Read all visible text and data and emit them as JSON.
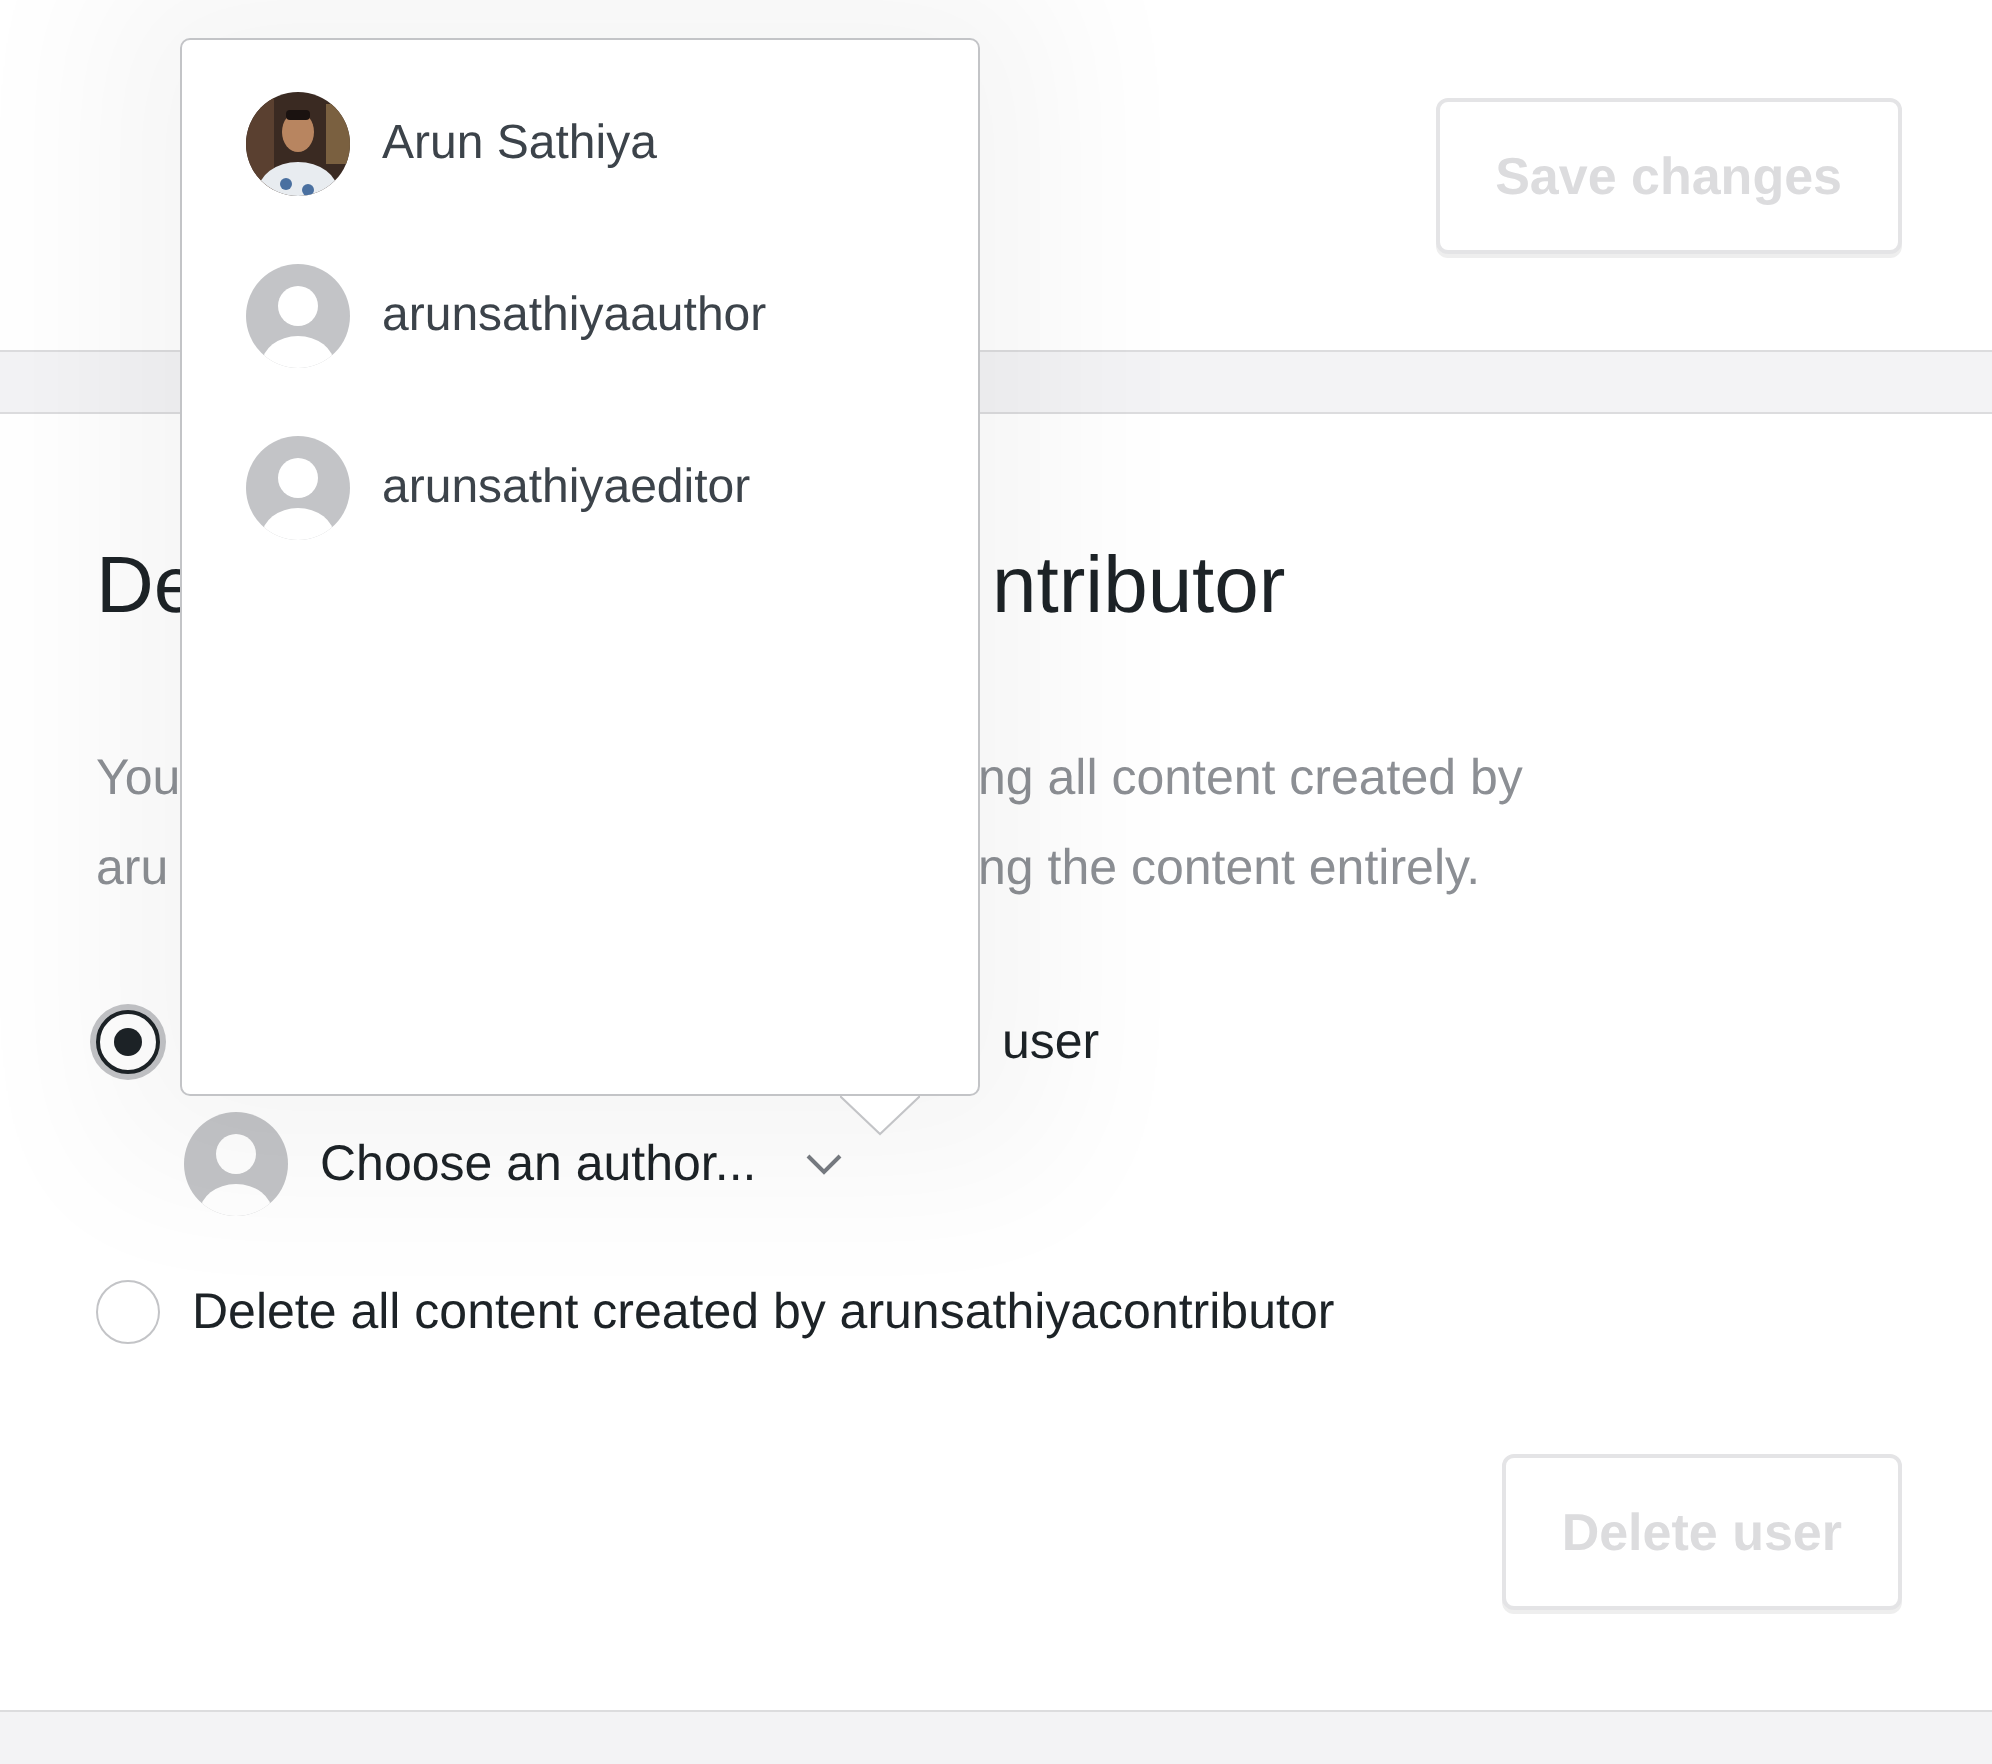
{
  "top_card": {
    "save_button": {
      "label": "Save changes",
      "disabled": true
    }
  },
  "delete_section": {
    "title_parts": [
      "De",
      "ntributor"
    ],
    "description_lines": [
      [
        "You",
        "ng all content created by"
      ],
      [
        "aru",
        "ng the content entirely."
      ]
    ],
    "options": [
      {
        "kind": "reassign",
        "label": "user",
        "selected": true,
        "author_select": {
          "label": "Choose an author..."
        }
      },
      {
        "kind": "delete",
        "label": "Delete all content created by arunsathiyacontributor",
        "selected": false
      }
    ],
    "delete_button": {
      "label": "Delete user",
      "disabled": true
    }
  },
  "author_menu": {
    "items": [
      {
        "name": "Arun Sathiya"
      },
      {
        "name": "arunsathiyaauthor",
        "kind": "default"
      },
      {
        "name": "arunsathiyaeditor",
        "kind": "default"
      }
    ]
  }
}
